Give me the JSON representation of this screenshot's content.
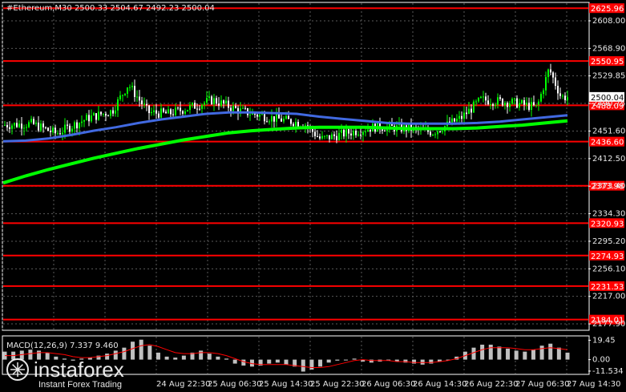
{
  "chart_data": [
    {
      "type": "candlestick",
      "title": "#Ethereum,M30  2500.33 2504.67 2492.23 2500.04",
      "x_labels": [
        "24 Aug 22:30",
        "25 Aug 06:30",
        "25 Aug 14:30",
        "25 Aug 22:30",
        "26 Aug 06:30",
        "26 Aug 14:30",
        "26 Aug 22:30",
        "27 Aug 06:30",
        "27 Aug 14:30"
      ],
      "y_ticks": [
        "2608.00",
        "2568.90",
        "2529.85",
        "2490.75",
        "2451.60",
        "2412.50",
        "2373.40",
        "2334.30",
        "2295.20",
        "2256.10",
        "2217.00",
        "2177.90"
      ],
      "ylim": [
        2170,
        2633
      ],
      "current_price": "2500.04",
      "levels": [
        "2625.96",
        "2550.95",
        "2488.09",
        "2436.60",
        "2373.98",
        "2320.93",
        "2274.93",
        "2231.53",
        "2184.01"
      ],
      "level_color": "#ff0000",
      "candle_up_color": "#00ff00",
      "candle_down_color": "#ffffff",
      "ma_fast_color": "#4169e1",
      "ma_slow_color": "#00ff00",
      "ma_fast_values": [
        2437,
        2438,
        2441,
        2446,
        2452,
        2457,
        2463,
        2468,
        2472,
        2476,
        2478,
        2478,
        2477,
        2476,
        2472,
        2469,
        2466,
        2463,
        2462,
        2462,
        2462,
        2463,
        2465,
        2468,
        2471,
        2474
      ],
      "ma_slow_values": [
        2378,
        2388,
        2397,
        2405,
        2413,
        2420,
        2427,
        2433,
        2439,
        2444,
        2449,
        2452,
        2454,
        2456,
        2457,
        2457,
        2457,
        2456,
        2455,
        2455,
        2455,
        2456,
        2458,
        2460,
        2463,
        2466
      ]
    },
    {
      "type": "macd",
      "title": "MACD(12,26,9) 7.337 9.460",
      "y_ticks": [
        "19.45",
        "0.00",
        "-11.534"
      ],
      "ylim": [
        -14,
        23
      ],
      "hist_color": "#c0c0c0",
      "signal_color": "#ff0000",
      "histogram": [
        8,
        8,
        9,
        10,
        9,
        7,
        3,
        1,
        -1,
        1,
        2,
        4,
        6,
        9,
        12,
        18,
        20,
        14,
        7,
        3,
        2,
        4,
        7,
        9,
        6,
        3,
        1,
        -4,
        -6,
        -7,
        -6,
        -4,
        -3,
        -5,
        -7,
        -12,
        -10,
        -7,
        -3,
        -1,
        0,
        1,
        -2,
        -3,
        -2,
        -1,
        -2,
        -3,
        -4,
        -5,
        -4,
        -2,
        0,
        3,
        8,
        12,
        15,
        15,
        13,
        11,
        9,
        8,
        10,
        14,
        16,
        12,
        7
      ],
      "signal": [
        4,
        4,
        5,
        6,
        7,
        7,
        6,
        5,
        3,
        2,
        2,
        3,
        4,
        6,
        8,
        11,
        14,
        15,
        13,
        10,
        7,
        6,
        6,
        7,
        7,
        6,
        4,
        1,
        -2,
        -4,
        -5,
        -5,
        -5,
        -5,
        -6,
        -7,
        -8,
        -8,
        -7,
        -5,
        -3,
        -1,
        0,
        -1,
        -1,
        -1,
        -2,
        -2,
        -3,
        -3,
        -3,
        -2,
        -1,
        1,
        4,
        7,
        10,
        12,
        12,
        12,
        11,
        10,
        10,
        11,
        12,
        11,
        10
      ]
    }
  ],
  "watermark": {
    "brand": "instaforex",
    "tagline": "Instant Forex Trading"
  }
}
